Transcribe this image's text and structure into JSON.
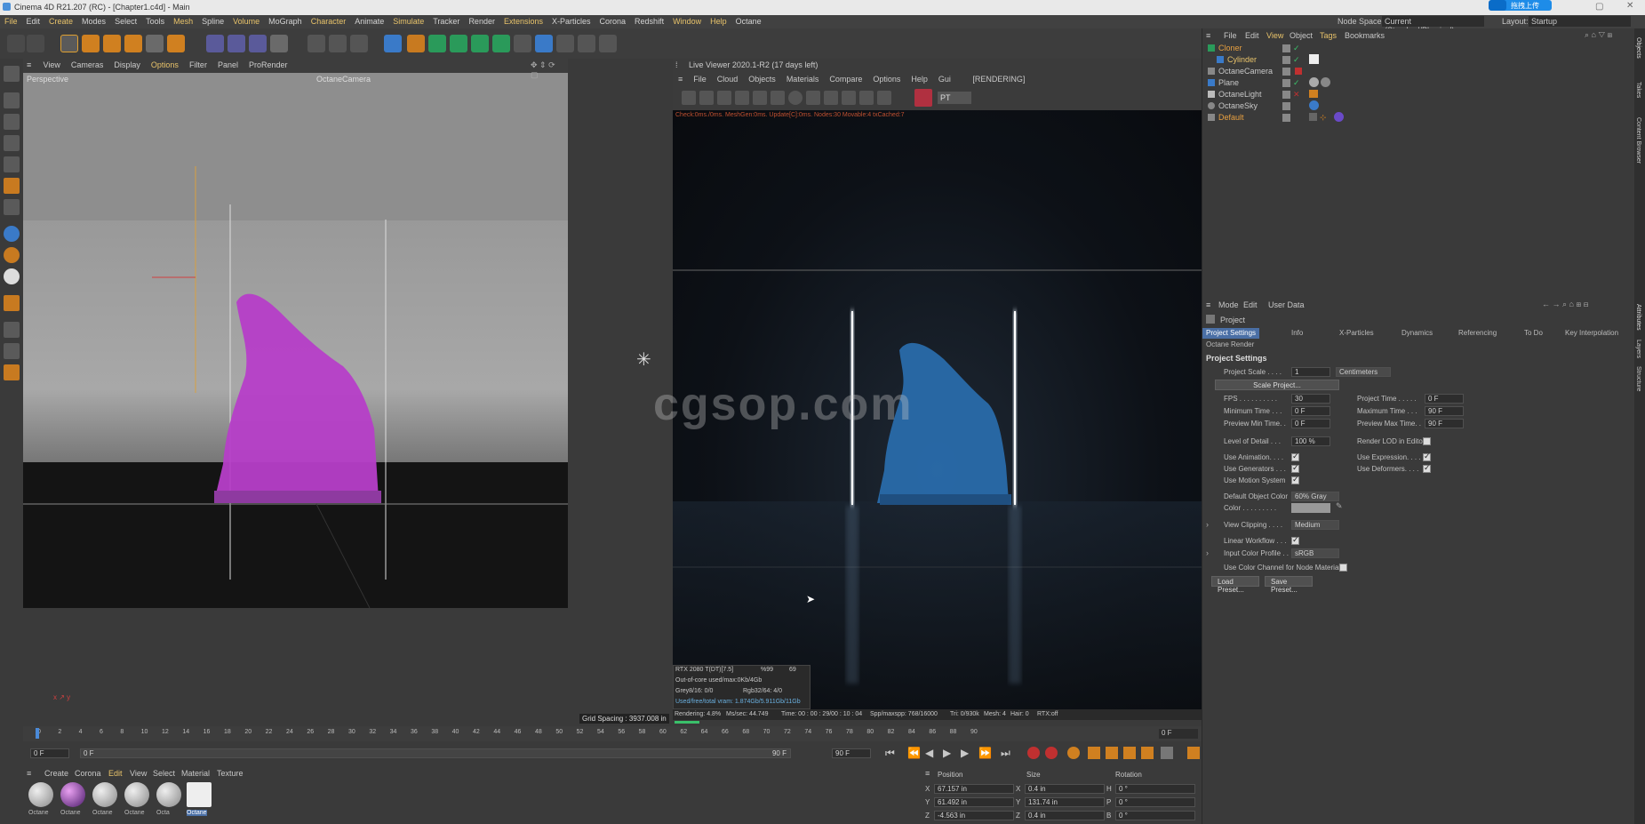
{
  "titlebar": {
    "title": "Cinema 4D R21.207 (RC) - [Chapter1.c4d] - Main",
    "upload_btn": "拖拽上传"
  },
  "menu": {
    "items": [
      "File",
      "Edit",
      "Create",
      "Modes",
      "Select",
      "Tools",
      "Mesh",
      "Spline",
      "Volume",
      "MoGraph",
      "Character",
      "Animate",
      "Simulate",
      "Tracker",
      "Render",
      "Extensions",
      "X-Particles",
      "Corona",
      "Redshift",
      "Window",
      "Help",
      "Octane"
    ],
    "node_space_label": "Node Space:",
    "node_space_value": "Current (Standard/Physical)",
    "layout_label": "Layout:",
    "layout_value": "Startup"
  },
  "viewport": {
    "menu": [
      "View",
      "Cameras",
      "Display",
      "Options",
      "Filter",
      "Panel",
      "ProRender"
    ],
    "name": "Perspective",
    "camera": "OctaneCamera",
    "grid_spacing": "Grid Spacing : 3937.008 in"
  },
  "liveviewer": {
    "title": "Live Viewer 2020.1-R2 (17 days left)",
    "menu": [
      "File",
      "Cloud",
      "Objects",
      "Materials",
      "Compare",
      "Options",
      "Help",
      "Gui"
    ],
    "status_tag": "[RENDERING]",
    "mode": "PT",
    "log": "Check:0ms./0ms. MeshGen:0ms. Update[C]:0ms. Nodes:30 Movable:4 txCached:7",
    "watermark": "cgsop.com",
    "stats": {
      "gpu": "RTX 2080 T(DT)[7.5]",
      "gpu_pct": "%99",
      "gpu_val": "69",
      "outofcore": "Out-of-core used/max:0Kb/4Gb",
      "grey": "Grey8/16: 0/0",
      "rgb": "Rgb32/64: 4/0",
      "vram": "Used/free/total vram: 1.874Gb/5.911Gb/11Gb"
    },
    "status": {
      "rendering": "Rendering: 4.8%",
      "mssec": "Ms/sec: 44.749",
      "time": "Time: 00 : 00 : 29/00 : 10 : 04",
      "spp": "Spp/maxspp: 768/16000",
      "tri": "Tri: 0/930k",
      "mesh": "Mesh: 4",
      "hair": "Hair: 0",
      "rtx": "RTX:off"
    }
  },
  "timeline": {
    "ticks": [
      "0",
      "2",
      "4",
      "6",
      "8",
      "10",
      "12",
      "14",
      "16",
      "18",
      "20",
      "22",
      "24",
      "26",
      "28",
      "30",
      "32",
      "34",
      "36",
      "38",
      "40",
      "42",
      "44",
      "46",
      "48",
      "50",
      "52",
      "54",
      "56",
      "58",
      "60",
      "62",
      "64",
      "66",
      "68",
      "70",
      "72",
      "74",
      "76",
      "78",
      "80",
      "82",
      "84",
      "86",
      "88",
      "90"
    ],
    "current": "0 F",
    "start": "0 F",
    "field2": "0 F",
    "end": "90 F",
    "end2": "90 F"
  },
  "materials": {
    "menu": [
      "Create",
      "Corona",
      "Edit",
      "View",
      "Select",
      "Material",
      "Texture"
    ],
    "items": [
      "Octane",
      "Octane",
      "Octane",
      "Octane",
      "Octa",
      "Octane"
    ]
  },
  "coords": {
    "headers": [
      "Position",
      "Size",
      "Rotation"
    ],
    "rows": [
      {
        "a": "X",
        "pv": "67.157 in",
        "b": "X",
        "sv": "0.4 in",
        "c": "H",
        "rv": "0 °"
      },
      {
        "a": "Y",
        "pv": "61.492 in",
        "b": "Y",
        "sv": "131.74 in",
        "c": "P",
        "rv": "0 °"
      },
      {
        "a": "Z",
        "pv": "-4.563 in",
        "b": "Z",
        "sv": "0.4 in",
        "c": "B",
        "rv": "0 °"
      }
    ]
  },
  "objmgr": {
    "menu": [
      "File",
      "Edit",
      "View",
      "Object",
      "Tags",
      "Bookmarks"
    ],
    "objects": [
      {
        "name": "Cloner",
        "color": "#e8a040"
      },
      {
        "name": "Cylinder",
        "color": "#e8c36a"
      },
      {
        "name": "OctaneCamera",
        "color": "#c8c8c8"
      },
      {
        "name": "Plane",
        "color": "#c8c8c8"
      },
      {
        "name": "OctaneLight",
        "color": "#c8c8c8"
      },
      {
        "name": "OctaneSky",
        "color": "#c8c8c8"
      },
      {
        "name": "Default",
        "color": "#c8c8c8"
      }
    ],
    "side_tabs": [
      "Objects",
      "Takes",
      "Content Browser"
    ]
  },
  "attr": {
    "menu": [
      "Mode",
      "Edit",
      "User Data"
    ],
    "title": "Project",
    "tabs": [
      "Project Settings",
      "Info",
      "X-Particles",
      "Dynamics",
      "Referencing",
      "To Do",
      "Key Interpolation"
    ],
    "tab2": "Octane Render",
    "section": "Project Settings",
    "project_scale_label": "Project Scale . . . .",
    "project_scale": "1",
    "units": "Centimeters",
    "scale_btn": "Scale Project...",
    "fps_label": "FPS . . . . . . . . . .",
    "fps": "30",
    "project_time_label": "Project Time . . . . .",
    "project_time": "0 F",
    "min_time_label": "Minimum Time . . .",
    "min_time": "0 F",
    "max_time_label": "Maximum Time . . .",
    "max_time": "90 F",
    "prev_min_label": "Preview Min Time. .",
    "prev_min": "0 F",
    "prev_max_label": "Preview Max Time. .",
    "prev_max": "90 F",
    "lod_label": "Level of Detail . . .",
    "lod": "100 %",
    "render_lod_label": "Render LOD in Editor",
    "use_anim": "Use Animation. . . .",
    "use_expr": "Use Expression. . . .",
    "use_gen": "Use Generators . . .",
    "use_def": "Use Deformers. . . .",
    "use_motion": "Use Motion System",
    "def_color_label": "Default Object Color",
    "def_color": "60% Gray",
    "color_label": "Color . . . . . . . . .",
    "view_clip_label": "View Clipping . . . .",
    "view_clip": "Medium",
    "linear_label": "Linear Workflow . . .",
    "input_profile_label": "Input Color Profile . .",
    "input_profile": "sRGB",
    "node_mat_label": "Use Color Channel for Node Material",
    "load_btn": "Load Preset...",
    "save_btn": "Save Preset...",
    "side_tabs": [
      "Attributes",
      "Layers",
      "Structure"
    ]
  }
}
